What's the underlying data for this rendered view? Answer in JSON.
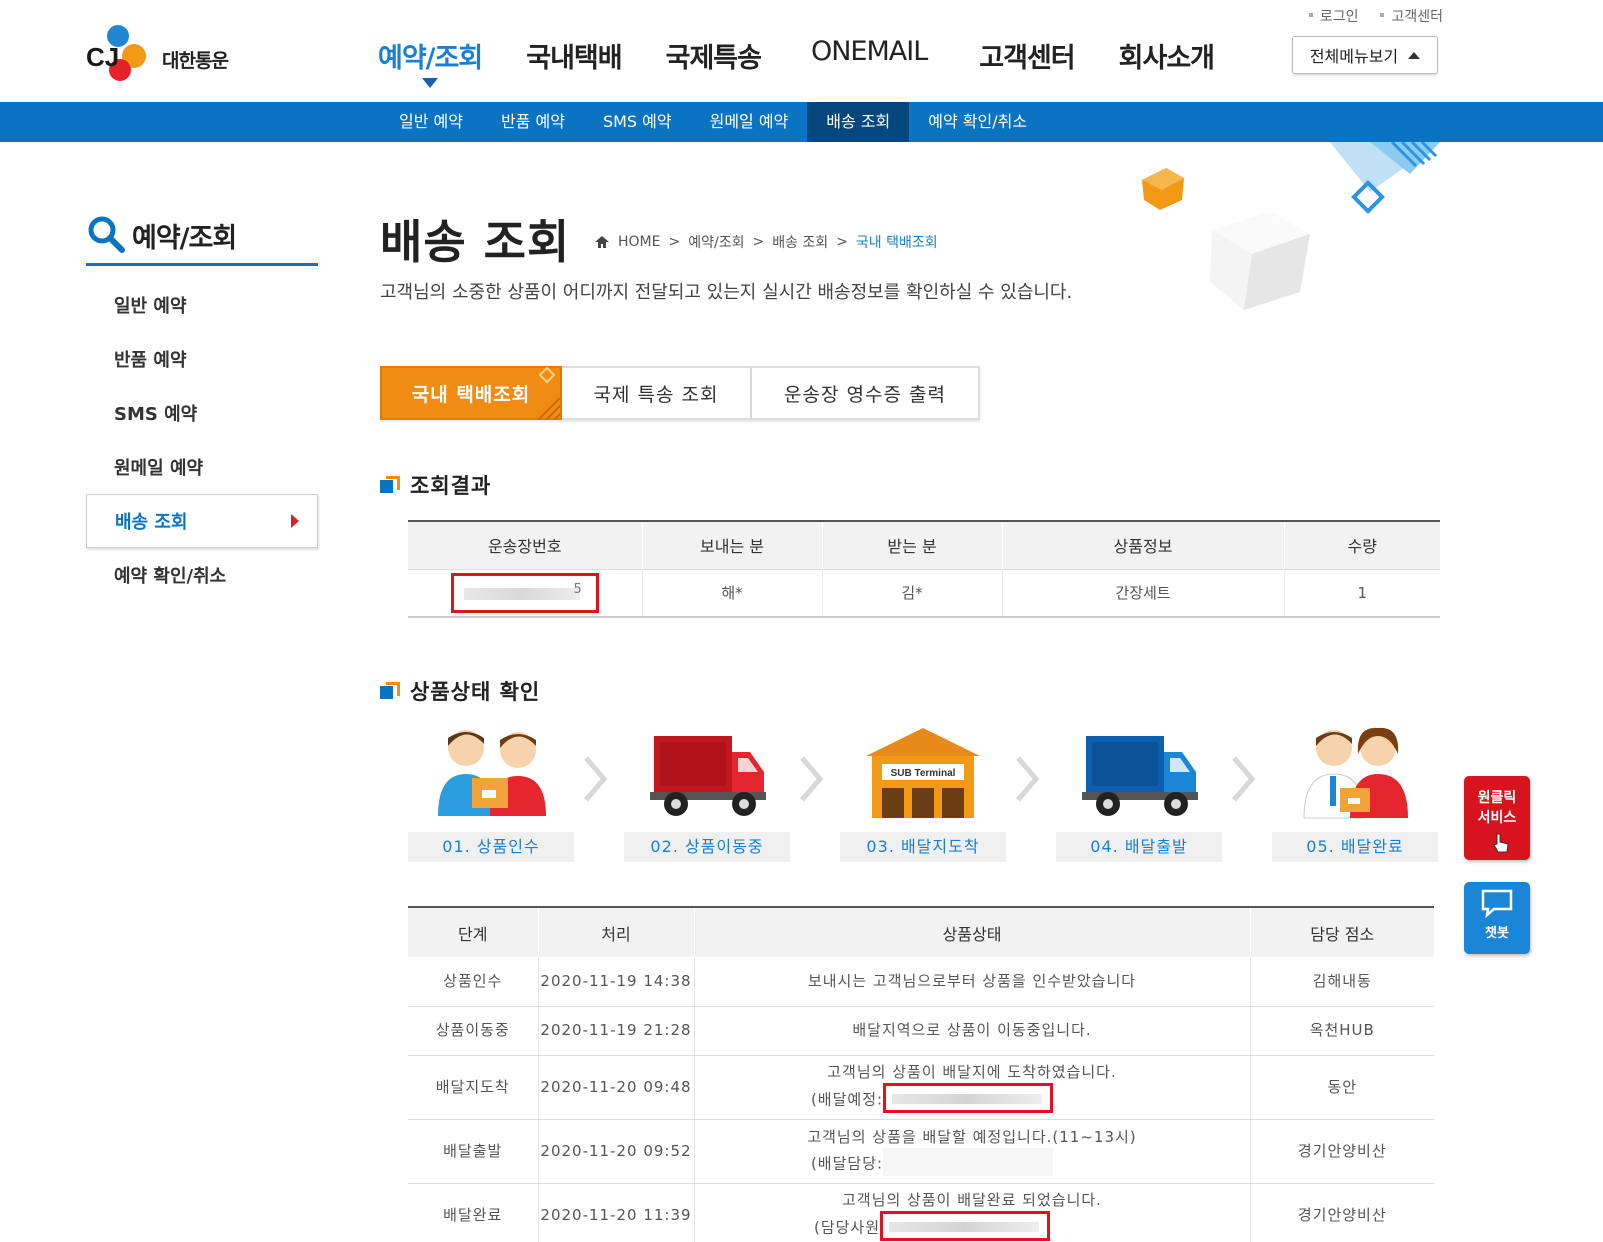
{
  "header": {
    "logo_text": "대한통운",
    "util_links": [
      "로그인",
      "고객센터"
    ],
    "gnb": [
      "예약/조회",
      "국내택배",
      "국제특송",
      "ONEMAIL",
      "고객센터",
      "회사소개"
    ],
    "all_menu_label": "전체메뉴보기"
  },
  "subnav": [
    "일반 예약",
    "반품 예약",
    "SMS 예약",
    "원메일 예약",
    "배송 조회",
    "예약 확인/취소"
  ],
  "sidebar": {
    "title": "예약/조회",
    "items": [
      "일반 예약",
      "반품 예약",
      "SMS 예약",
      "원메일 예약",
      "배송 조회",
      "예약 확인/취소"
    ]
  },
  "main": {
    "title": "배송 조회",
    "breadcrumb": [
      "HOME",
      "예약/조회",
      "배송 조회",
      "국내 택배조회"
    ],
    "description": "고객님의 소중한 상품이 어디까지 전달되고 있는지 실시간 배송정보를 확인하실 수 있습니다.",
    "tabs": [
      "국내 택배조회",
      "국제 특송 조회",
      "운송장 영수증 출력"
    ]
  },
  "result": {
    "title": "조회결과",
    "headers": [
      "운송장번호",
      "보내는 분",
      "받는 분",
      "상품정보",
      "수량"
    ],
    "row": {
      "tracking_tail": "5",
      "sender": "해*",
      "receiver": "김*",
      "product": "간장세트",
      "qty": "1"
    }
  },
  "status": {
    "title": "상품상태 확인",
    "steps": [
      "01. 상품인수",
      "02. 상품이동중",
      "03. 배달지도착",
      "04. 배달출발",
      "05. 배달완료"
    ],
    "terminal_sign": "SUB Terminal"
  },
  "history": {
    "headers": [
      "단계",
      "처리",
      "상품상태",
      "담당 점소"
    ],
    "rows": [
      {
        "stage": "상품인수",
        "time": "2020-11-19 14:38",
        "line1": "보내시는 고객님으로부터 상품을 인수받았습니다",
        "line2": "",
        "office": "김해내동"
      },
      {
        "stage": "상품이동중",
        "time": "2020-11-19 21:28",
        "line1": "배달지역으로 상품이 이동중입니다.",
        "line2": "",
        "office": "옥천HUB"
      },
      {
        "stage": "배달지도착",
        "time": "2020-11-20 09:48",
        "line1": "고객님의 상품이 배달지에 도착하였습니다.",
        "line2": "(배달예정:",
        "office": "동안"
      },
      {
        "stage": "배달출발",
        "time": "2020-11-20 09:52",
        "line1": "고객님의 상품을 배달할 예정입니다.(11~13시)",
        "line2": "(배달담당:",
        "office": "경기안양비산"
      },
      {
        "stage": "배달완료",
        "time": "2020-11-20 11:39",
        "line1": "고객님의 상품이 배달완료 되었습니다.",
        "line2": "(담당사원",
        "office": "경기안양비산"
      }
    ]
  },
  "floating": {
    "oneclick": "원클릭 서비스",
    "chatbot": "챗봇"
  },
  "colors": {
    "brand_blue": "#0a74c2",
    "accent_orange": "#f08c12",
    "alert_red": "#e0131b"
  }
}
